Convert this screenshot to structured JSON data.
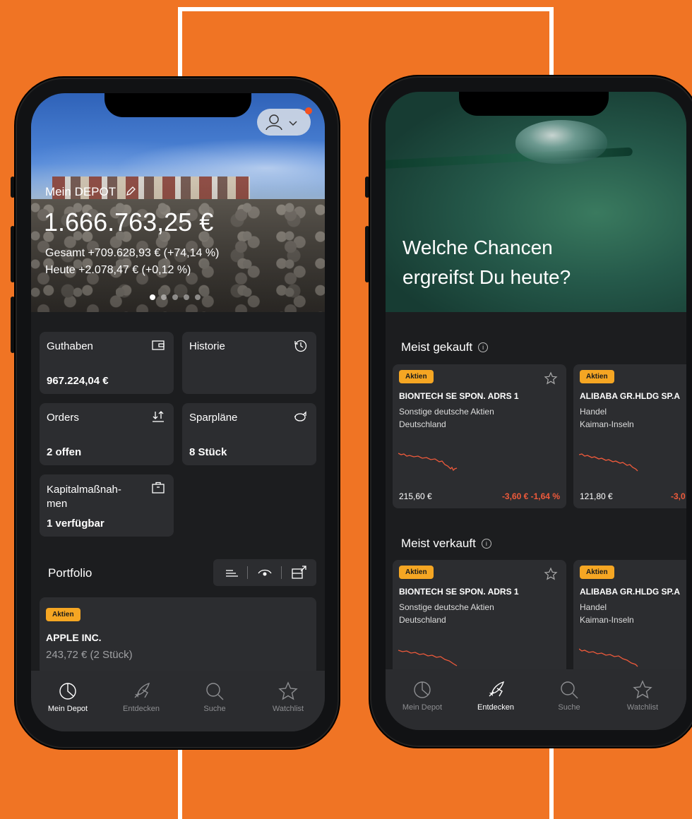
{
  "colors": {
    "background": "#f07424",
    "accent": "#f5a623",
    "negative": "#ef5a3b",
    "tile": "#2c2d30",
    "screen": "#1c1d1f"
  },
  "left": {
    "header": {
      "depot_label": "Mein DEPOT",
      "value": "1.666.763,25 €",
      "total": "Gesamt +709.628,93 € (+74,14 %)",
      "today": "Heute +2.078,47 € (+0,12 %)"
    },
    "tiles": [
      {
        "label": "Guthaben",
        "value": "967.224,04 €",
        "icon": "wallet-icon"
      },
      {
        "label": "Historie",
        "value": "",
        "icon": "history-icon"
      },
      {
        "label": "Orders",
        "value": "2 offen",
        "icon": "sort-icon"
      },
      {
        "label": "Sparpläne",
        "value": "8 Stück",
        "icon": "piggy-bank-icon"
      },
      {
        "label": "Kapitalmaßnah-\nmen",
        "value": "1 verfügbar",
        "icon": "briefcase-icon"
      }
    ],
    "portfolio": {
      "title": "Portfolio",
      "card": {
        "badge": "Aktien",
        "name": "APPLE INC.",
        "detail": "243,72 € (2 Stück)"
      }
    },
    "tabs": [
      "Mein Depot",
      "Entdecken",
      "Suche",
      "Watchlist"
    ]
  },
  "right": {
    "hero_title": "Welche Chancen\nergreifst Du heute?",
    "sections": [
      {
        "title": "Meist gekauft",
        "cards": [
          {
            "badge": "Aktien",
            "name": "BIONTECH SE SPON. ADRS 1",
            "sub1": "Sonstige deutsche Aktien",
            "sub2": "Deutschland",
            "price": "215,60 €",
            "change": "-3,60 €  -1,64 %"
          },
          {
            "badge": "Aktien",
            "name": "ALIBABA GR.HLDG SP.A",
            "sub1": "Handel",
            "sub2": "Kaiman-Inseln",
            "price": "121,80 €",
            "change": "-3,0"
          }
        ]
      },
      {
        "title": "Meist verkauft",
        "cards": [
          {
            "badge": "Aktien",
            "name": "BIONTECH SE SPON. ADRS 1",
            "sub1": "Sonstige deutsche Aktien",
            "sub2": "Deutschland"
          },
          {
            "badge": "Aktien",
            "name": "ALIBABA GR.HLDG SP.A",
            "sub1": "Handel",
            "sub2": "Kaiman-Inseln"
          }
        ]
      }
    ],
    "tabs": [
      "Mein Depot",
      "Entdecken",
      "Suche",
      "Watchlist"
    ]
  }
}
